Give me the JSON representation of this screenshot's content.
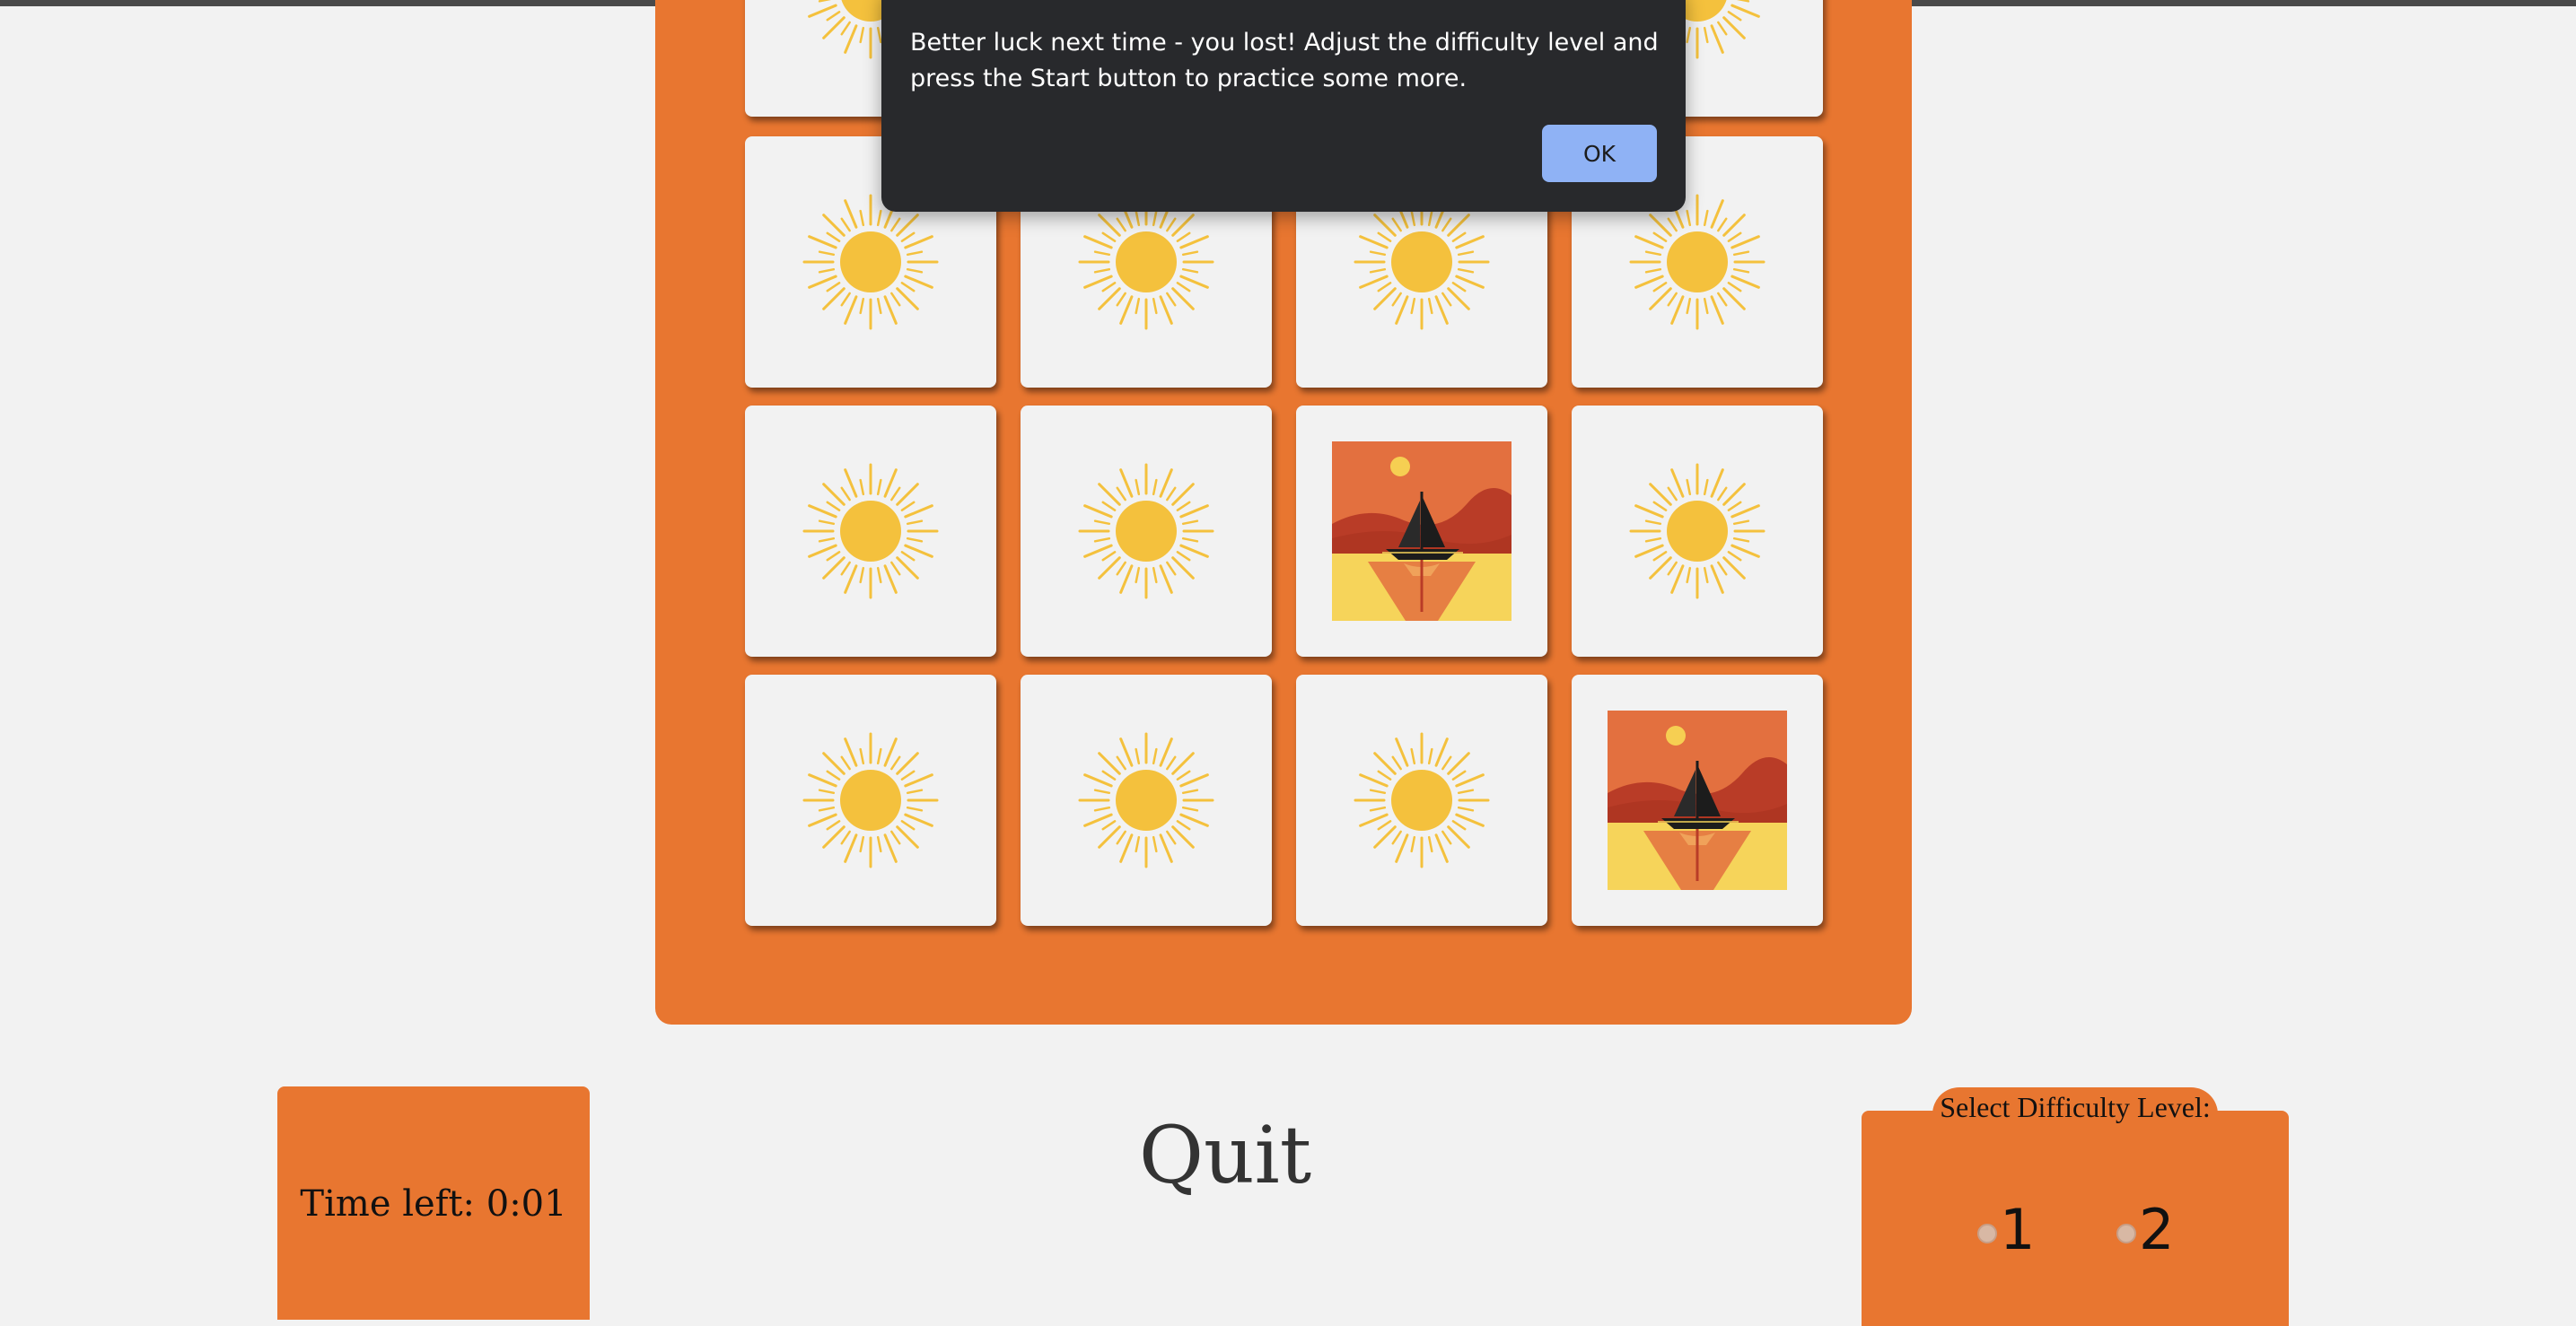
{
  "dialog": {
    "message": "Better luck next time - you lost! Adjust the difficulty level and press the Start button to practice some more.",
    "ok_label": "OK"
  },
  "board": {
    "rows": [
      [
        "sun",
        "hidden",
        "hidden",
        "sun"
      ],
      [
        "sun",
        "sun",
        "sun",
        "sun"
      ],
      [
        "sun",
        "sun",
        "sailboat",
        "sun"
      ],
      [
        "sun",
        "sun",
        "sun",
        "sailboat"
      ]
    ],
    "icons": {
      "sun": "sun-icon",
      "sailboat": "sailboat-sunset-image"
    }
  },
  "timer": {
    "text": "Time left: 0:01"
  },
  "quit": {
    "label": "Quit"
  },
  "difficulty": {
    "title": "Select Difficulty Level:",
    "options": [
      "1",
      "2"
    ]
  },
  "colors": {
    "board": "#e87630",
    "card": "#f2f2f2",
    "sun": "#f4c13d",
    "dialog": "#28292c",
    "ok_button": "#8fb2f5"
  }
}
